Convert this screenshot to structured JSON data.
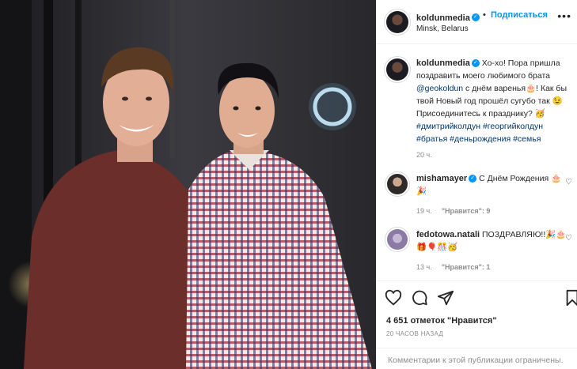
{
  "post": {
    "username": "koldunmedia",
    "follow_label": "Подписаться",
    "location": "Minsk, Belarus",
    "caption_text": "Хо-хо! Пора пришла поздравить моего любимого брата",
    "caption_mention": "@geokoldun",
    "caption_text2": "с днём варенья🎂! Как бы твой Новый год прошёл сугубо так 😉 Присоединитесь к празднику? 🥳",
    "hashtags": "#дмитрийколдун #георгийколдун #братья #деньрождения #семья",
    "caption_time": "20 ч.",
    "likes": "4 651 отметок \"Нравится\"",
    "posted_ago": "20 ЧАСОВ НАЗАД",
    "comments_restricted": "Комментарии к этой публикации ограничены."
  },
  "comments": [
    {
      "username": "mishamayer",
      "verified": true,
      "text": "С Днём Рождения 🎂🎉",
      "time": "19 ч.",
      "likes_label": "\"Нравится\": 9"
    },
    {
      "username": "fedotowa.natali",
      "verified": false,
      "text": "ПОЗДРАВЛЯЮ!!🎉🎂🎁🎈🎊🥳",
      "time": "13 ч.",
      "likes_label": "\"Нравится\": 1"
    }
  ],
  "icons": {
    "like": "heart-icon",
    "comment": "comment-icon",
    "share": "share-icon",
    "save": "bookmark-icon"
  },
  "colors": {
    "accent": "#0095f6",
    "text": "#262626",
    "muted": "#8e8e8e",
    "link": "#00376b"
  }
}
